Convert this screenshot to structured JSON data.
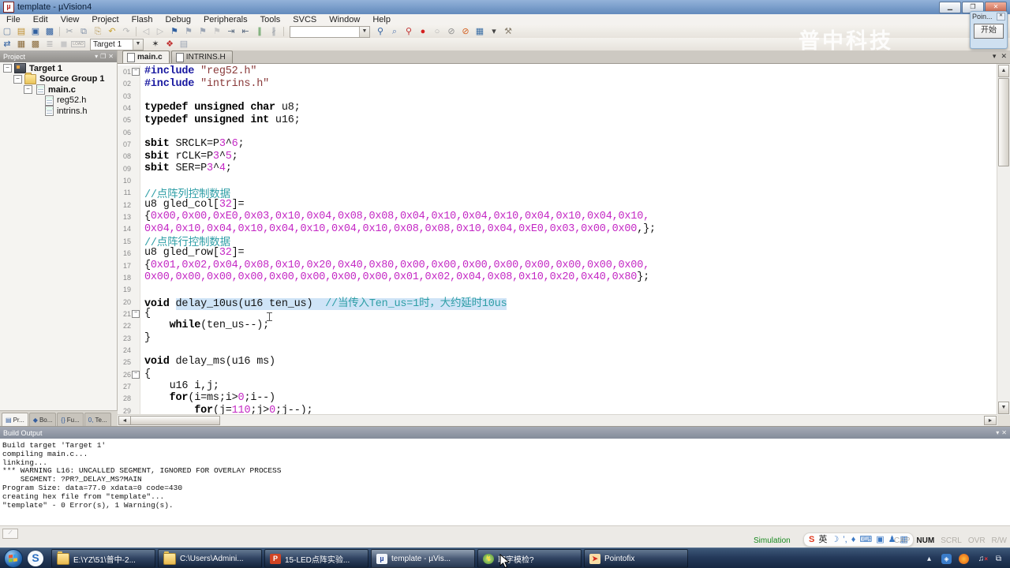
{
  "window": {
    "title": "template - µVision4",
    "watermark": "普中科技",
    "controls": [
      "–",
      "❐",
      "✕"
    ]
  },
  "menu": {
    "items": [
      "File",
      "Edit",
      "View",
      "Project",
      "Flash",
      "Debug",
      "Peripherals",
      "Tools",
      "SVCS",
      "Window",
      "Help"
    ]
  },
  "toolbar1": {
    "left_icons": [
      {
        "name": "new-file-icon",
        "g": "▢",
        "c": "#6b86a8"
      },
      {
        "name": "open-file-icon",
        "g": "▤",
        "c": "#c09030"
      },
      {
        "name": "save-icon",
        "g": "▣",
        "c": "#2f5fa0"
      },
      {
        "name": "save-all-icon",
        "g": "▩",
        "c": "#2f5fa0"
      },
      {
        "name": "separator",
        "g": "|",
        "c": "sep"
      },
      {
        "name": "cut-icon",
        "g": "✂",
        "c": "#9aa0a8"
      },
      {
        "name": "copy-icon",
        "g": "⧉",
        "c": "#8090a8"
      },
      {
        "name": "paste-icon",
        "g": "⎘",
        "c": "#b89a5a"
      },
      {
        "name": "undo-icon",
        "g": "↶",
        "c": "#c8a030"
      },
      {
        "name": "redo-icon",
        "g": "↷",
        "c": "#b8b8b8"
      },
      {
        "name": "separator",
        "g": "|",
        "c": "sep"
      },
      {
        "name": "nav-back-icon",
        "g": "◁",
        "c": "#b8b8b8"
      },
      {
        "name": "nav-forward-icon",
        "g": "▷",
        "c": "#b8b8b8"
      },
      {
        "name": "bookmark-toggle-icon",
        "g": "⚑",
        "c": "#2f5fa0"
      },
      {
        "name": "bookmark-prev-icon",
        "g": "⚑",
        "c": "#9aa4b4"
      },
      {
        "name": "bookmark-next-icon",
        "g": "⚑",
        "c": "#9aa4b4"
      },
      {
        "name": "bookmark-clear-icon",
        "g": "⚑",
        "c": "#c4c4c4"
      },
      {
        "name": "indent-icon",
        "g": "⇥",
        "c": "#5a6a80"
      },
      {
        "name": "outdent-icon",
        "g": "⇤",
        "c": "#5a6a80"
      },
      {
        "name": "comment-icon",
        "g": "∥",
        "c": "#3a8a3a"
      },
      {
        "name": "uncomment-icon",
        "g": "∦",
        "c": "#9aa0a8"
      },
      {
        "name": "separator",
        "g": "|",
        "c": "sep"
      }
    ],
    "find_value": "",
    "right_icons": [
      {
        "name": "find-in-files-icon",
        "g": "⚲",
        "c": "#2f5fa0"
      },
      {
        "name": "find-icon",
        "g": "⌕",
        "c": "#5a7ab0"
      },
      {
        "name": "find-next-icon",
        "g": "⚲",
        "c": "#c03030"
      },
      {
        "name": "breakpoint-toggle-icon",
        "g": "●",
        "c": "#d42020"
      },
      {
        "name": "breakpoint-enable-icon",
        "g": "○",
        "c": "#b0b0b0"
      },
      {
        "name": "breakpoint-disable-icon",
        "g": "⊘",
        "c": "#909090"
      },
      {
        "name": "breakpoint-kill-icon",
        "g": "⊘",
        "c": "#d46020"
      },
      {
        "name": "window-layout-icon",
        "g": "▦",
        "c": "#3a6ea5"
      },
      {
        "name": "layout-dropdown-icon",
        "g": "▾",
        "c": "#444444"
      },
      {
        "name": "configure-wrench-icon",
        "g": "⚒",
        "c": "#8a8070"
      }
    ]
  },
  "toolbar2": {
    "icons_left": [
      {
        "name": "translate-icon",
        "g": "⇄",
        "c": "#2f5fa0"
      },
      {
        "name": "build-icon",
        "g": "▦",
        "c": "#8a6a3a"
      },
      {
        "name": "rebuild-icon",
        "g": "▩",
        "c": "#8a6a3a"
      },
      {
        "name": "batch-build-icon",
        "g": "≣",
        "c": "#b8b8b8"
      },
      {
        "name": "stop-build-icon",
        "g": "◼",
        "c": "#c8c8c8"
      },
      {
        "name": "download-icon",
        "g": "LOAD",
        "c": "load"
      }
    ],
    "target_select": "Target 1",
    "icons_right": [
      {
        "name": "options-for-target-icon",
        "g": "✶",
        "c": "#3a3a3a"
      },
      {
        "name": "manage-components-icon",
        "g": "❖",
        "c": "#c03030"
      },
      {
        "name": "books-icon",
        "g": "▤",
        "c": "#9aa4b4"
      }
    ]
  },
  "project_panel": {
    "title": "Project",
    "header_buttons": [
      "▾",
      "❐",
      "✕"
    ],
    "tree": [
      {
        "label": "Target 1",
        "level": 0,
        "icon": "target",
        "expander": true,
        "bold": true
      },
      {
        "label": "Source Group 1",
        "level": 1,
        "icon": "folder",
        "expander": true,
        "bold": true
      },
      {
        "label": "main.c",
        "level": 2,
        "icon": "page",
        "expander": true,
        "bold": true
      },
      {
        "label": "reg52.h",
        "level": 3,
        "icon": "page",
        "expander": false,
        "bold": false
      },
      {
        "label": "intrins.h",
        "level": 3,
        "icon": "page",
        "expander": false,
        "bold": false
      }
    ],
    "bottom_tabs": [
      {
        "icon": "▤",
        "label": "Pr...",
        "active": true
      },
      {
        "icon": "◆",
        "label": "Bo...",
        "active": false
      },
      {
        "icon": "{}",
        "label": "Fu...",
        "active": false
      },
      {
        "icon": "0,",
        "label": "Te...",
        "active": false
      }
    ]
  },
  "editor": {
    "tabs": [
      {
        "label": "main.c",
        "active": true
      },
      {
        "label": "INTRINS.H",
        "active": false
      }
    ],
    "tab_buttons": [
      "▾",
      "✕"
    ],
    "code_lines": [
      {
        "n": "01",
        "fold": true,
        "segs": [
          [
            "pp",
            "#include"
          ],
          [
            "pln",
            " "
          ],
          [
            "str",
            "\"reg52.h\""
          ]
        ]
      },
      {
        "n": "02",
        "segs": [
          [
            "pp",
            "#include"
          ],
          [
            "pln",
            " "
          ],
          [
            "str",
            "\"intrins.h\""
          ]
        ]
      },
      {
        "n": "03",
        "segs": []
      },
      {
        "n": "04",
        "segs": [
          [
            "kw",
            "typedef unsigned char"
          ],
          [
            "pln",
            " u8;"
          ]
        ]
      },
      {
        "n": "05",
        "segs": [
          [
            "kw",
            "typedef unsigned int"
          ],
          [
            "pln",
            " u16;"
          ]
        ]
      },
      {
        "n": "06",
        "segs": []
      },
      {
        "n": "07",
        "segs": [
          [
            "kw",
            "sbit"
          ],
          [
            "pln",
            " SRCLK=P"
          ],
          [
            "num",
            "3"
          ],
          [
            "pln",
            "^"
          ],
          [
            "num",
            "6"
          ],
          [
            "pln",
            ";"
          ]
        ]
      },
      {
        "n": "08",
        "segs": [
          [
            "kw",
            "sbit"
          ],
          [
            "pln",
            " rCLK=P"
          ],
          [
            "num",
            "3"
          ],
          [
            "pln",
            "^"
          ],
          [
            "num",
            "5"
          ],
          [
            "pln",
            ";"
          ]
        ]
      },
      {
        "n": "09",
        "segs": [
          [
            "kw",
            "sbit"
          ],
          [
            "pln",
            " SER=P"
          ],
          [
            "num",
            "3"
          ],
          [
            "pln",
            "^"
          ],
          [
            "num",
            "4"
          ],
          [
            "pln",
            ";"
          ]
        ]
      },
      {
        "n": "10",
        "segs": []
      },
      {
        "n": "11",
        "segs": [
          [
            "com",
            "//点阵列控制数据"
          ]
        ]
      },
      {
        "n": "12",
        "segs": [
          [
            "pln",
            "u8 gled_col["
          ],
          [
            "num",
            "32"
          ],
          [
            "pln",
            "]="
          ]
        ]
      },
      {
        "n": "13",
        "segs": [
          [
            "pln",
            "{"
          ],
          [
            "num",
            "0x00,0x00,0xE0,0x03,0x10,0x04,0x08,0x08,0x04,0x10,0x04,0x10,0x04,0x10,0x04,0x10,"
          ]
        ]
      },
      {
        "n": "14",
        "segs": [
          [
            "num",
            "0x04,0x10,0x04,0x10,0x04,0x10,0x04,0x10,0x08,0x08,0x10,0x04,0xE0,0x03,0x00,0x00"
          ],
          [
            "pln",
            ",};"
          ]
        ]
      },
      {
        "n": "15",
        "segs": [
          [
            "com",
            "//点阵行控制数据"
          ]
        ]
      },
      {
        "n": "16",
        "segs": [
          [
            "pln",
            "u8 gled_row["
          ],
          [
            "num",
            "32"
          ],
          [
            "pln",
            "]="
          ]
        ]
      },
      {
        "n": "17",
        "segs": [
          [
            "pln",
            "{"
          ],
          [
            "num",
            "0x01,0x02,0x04,0x08,0x10,0x20,0x40,0x80,0x00,0x00,0x00,0x00,0x00,0x00,0x00,0x00,"
          ]
        ]
      },
      {
        "n": "18",
        "segs": [
          [
            "num",
            "0x00,0x00,0x00,0x00,0x00,0x00,0x00,0x00,0x01,0x02,0x04,0x08,0x10,0x20,0x40,0x80"
          ],
          [
            "pln",
            "};"
          ]
        ]
      },
      {
        "n": "19",
        "segs": []
      },
      {
        "n": "20",
        "segs": [
          [
            "kw",
            "void"
          ],
          [
            "pln",
            " "
          ],
          [
            "hlpln",
            "delay_10us(u16 ten_us)  "
          ],
          [
            "hlcom",
            "//当传入Ten_us=1时，大约延时10us"
          ]
        ]
      },
      {
        "n": "21",
        "fold": true,
        "segs": [
          [
            "pln",
            "{"
          ]
        ]
      },
      {
        "n": "22",
        "segs": [
          [
            "pln",
            "    "
          ],
          [
            "kw",
            "while"
          ],
          [
            "pln",
            "(ten_us--);"
          ]
        ]
      },
      {
        "n": "23",
        "segs": [
          [
            "pln",
            "}"
          ]
        ]
      },
      {
        "n": "24",
        "segs": []
      },
      {
        "n": "25",
        "segs": [
          [
            "kw",
            "void"
          ],
          [
            "pln",
            " delay_ms(u16 ms)"
          ]
        ]
      },
      {
        "n": "26",
        "fold": true,
        "segs": [
          [
            "pln",
            "{"
          ]
        ]
      },
      {
        "n": "27",
        "segs": [
          [
            "pln",
            "    u16 i,j;"
          ]
        ]
      },
      {
        "n": "28",
        "segs": [
          [
            "pln",
            "    "
          ],
          [
            "kw",
            "for"
          ],
          [
            "pln",
            "(i=ms;i>"
          ],
          [
            "num",
            "0"
          ],
          [
            "pln",
            ";i--)"
          ]
        ]
      },
      {
        "n": "29",
        "segs": [
          [
            "pln",
            "        "
          ],
          [
            "kw",
            "for"
          ],
          [
            "pln",
            "(j="
          ],
          [
            "num",
            "110"
          ],
          [
            "pln",
            ";j>"
          ],
          [
            "num",
            "0"
          ],
          [
            "pln",
            ";j--);"
          ]
        ]
      }
    ]
  },
  "build_output": {
    "title": "Build Output",
    "header_buttons": [
      "▾",
      "✕"
    ],
    "lines": [
      "Build target 'Target 1'",
      "compiling main.c...",
      "linking...",
      "*** WARNING L16: UNCALLED SEGMENT, IGNORED FOR OVERLAY PROCESS",
      "    SEGMENT: ?PR?_DELAY_MS?MAIN",
      "Program Size: data=77.0 xdata=0 code=430",
      "creating hex file from \"template\"...",
      "\"template\" - 0 Error(s), 1 Warning(s)."
    ]
  },
  "status_bar": {
    "simulation_label": "Simulation",
    "ime": {
      "icons": [
        {
          "name": "sogou-logo-icon",
          "g": "S",
          "c": "#e03a1e",
          "bold": true
        },
        {
          "name": "lang-indicator",
          "g": "英",
          "c": "#222222",
          "bold": false
        },
        {
          "name": "night-mode-icon",
          "g": "☽",
          "c": "#3b78c3",
          "bold": false
        },
        {
          "name": "punctuation-icon",
          "g": "’,",
          "c": "#3b78c3",
          "bold": false
        },
        {
          "name": "mic-icon",
          "g": "♦",
          "c": "#3b78c3",
          "bold": false
        },
        {
          "name": "keyboard-icon",
          "g": "⌨",
          "c": "#3b78c3",
          "bold": false
        },
        {
          "name": "toolbox-icon",
          "g": "▣",
          "c": "#3b78c3",
          "bold": false
        },
        {
          "name": "skin-icon",
          "g": "♟",
          "c": "#3b78c3",
          "bold": false
        },
        {
          "name": "grid-icon",
          "g": "▦",
          "c": "#3b78c3",
          "bold": false
        }
      ]
    },
    "indicators": [
      {
        "t": "CAP",
        "on": false
      },
      {
        "t": "NUM",
        "on": true
      },
      {
        "t": "SCRL",
        "on": false
      },
      {
        "t": "OVR",
        "on": false
      },
      {
        "t": "R/W",
        "on": false
      }
    ]
  },
  "taskbar": {
    "buttons": [
      {
        "icon": "folder",
        "glyph": "",
        "label": "E:\\YZ\\51\\普中-2...",
        "active": false
      },
      {
        "icon": "folder",
        "glyph": "",
        "label": "C:\\Users\\Admini...",
        "active": false
      },
      {
        "icon": "ppt",
        "glyph": "P",
        "label": "15-LED点阵实验...",
        "active": false
      },
      {
        "icon": "uvision",
        "glyph": "µ",
        "label": "template  - µVis...",
        "active": true
      },
      {
        "icon": "fonttool",
        "glyph": "↯",
        "label": "取字模检?",
        "active": false
      },
      {
        "icon": "pointofix",
        "glyph": "➤",
        "label": "Pointofix",
        "active": false
      }
    ],
    "tray": [
      {
        "name": "tray-expand-icon",
        "g": "▴",
        "cls": ""
      },
      {
        "name": "tray-app-blue-icon",
        "g": "◈",
        "cls": "blue"
      },
      {
        "name": "tray-security-icon",
        "g": "",
        "cls": "orange"
      },
      {
        "name": "volume-muted-icon",
        "g": "♫",
        "cls": "mute"
      },
      {
        "name": "network-icon",
        "g": "⧉",
        "cls": ""
      }
    ]
  },
  "float_window": {
    "title": "Poin...",
    "close": "✕",
    "button": "开始"
  }
}
